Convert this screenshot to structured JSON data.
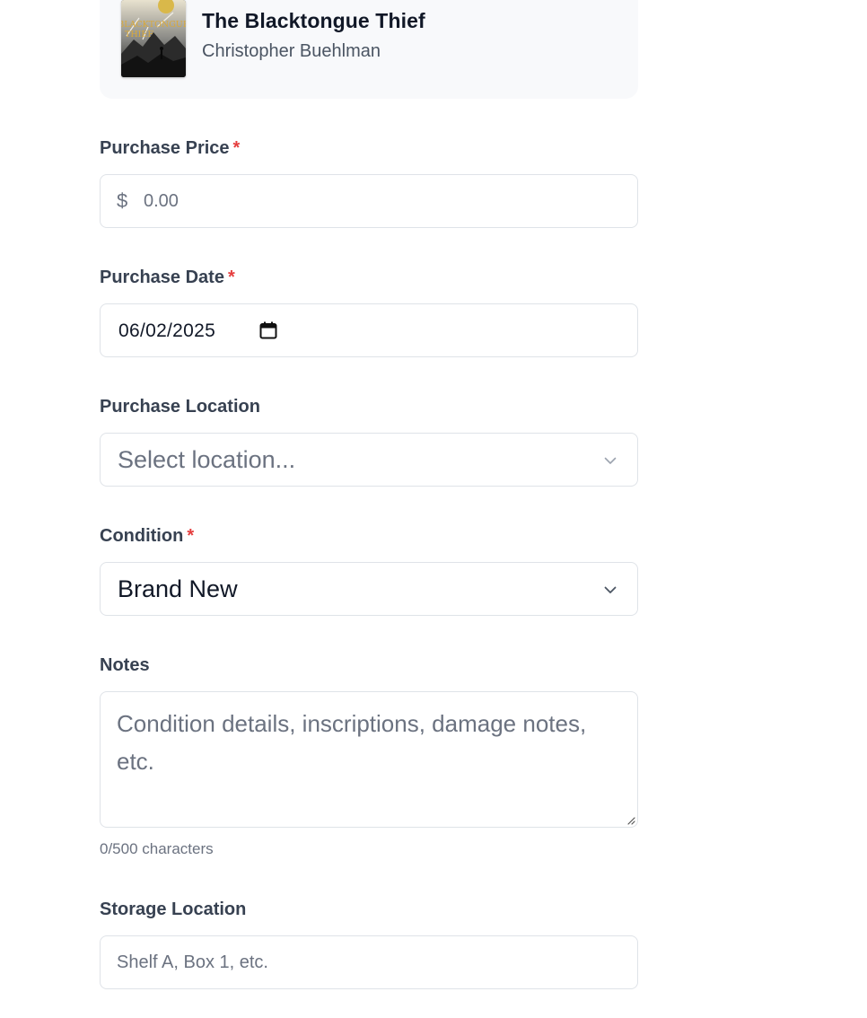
{
  "book": {
    "title": "The Blacktongue Thief",
    "author": "Christopher Buehlman",
    "cover_text_line1": "BLACKTONGUE",
    "cover_text_line2": "THIEF"
  },
  "form": {
    "required_marker": "*",
    "purchase_price": {
      "label": "Purchase Price",
      "currency_symbol": "$",
      "placeholder": "0.00",
      "required": true
    },
    "purchase_date": {
      "label": "Purchase Date",
      "value": "06/02/2025",
      "required": true
    },
    "purchase_location": {
      "label": "Purchase Location",
      "placeholder": "Select location..."
    },
    "condition": {
      "label": "Condition",
      "value": "Brand New",
      "required": true
    },
    "notes": {
      "label": "Notes",
      "placeholder": "Condition details, inscriptions, damage notes, etc.",
      "char_count": "0/500 characters"
    },
    "storage_location": {
      "label": "Storage Location",
      "placeholder": "Shelf A, Box 1, etc."
    }
  },
  "colors": {
    "required": "#e53e3e",
    "border": "#dfe3e8",
    "card_background": "#f8f9fb"
  }
}
